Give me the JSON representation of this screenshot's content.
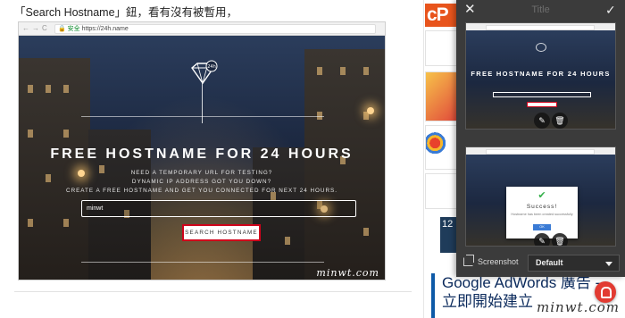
{
  "article": {
    "caption": "「Search Hostname」鈕，看有沒有被暫用，"
  },
  "mini_browser": {
    "nav_glyphs": "←→C",
    "secure_label": "安全",
    "url": "https://24h.name"
  },
  "hero": {
    "logo_text": "24h",
    "title": "FREE HOSTNAME FOR 24 HOURS",
    "sub_lines": [
      "NEED A TEMPORARY URL FOR TESTING?",
      "DYNAMIC IP ADDRESS GOT YOU DOWN?",
      "CREATE A FREE HOSTNAME AND GET YOU CONNECTED FOR NEXT 24 HOURS."
    ],
    "input_value": "minwt",
    "button_label": "SEARCH HOSTNAME",
    "watermark": "minwt.com"
  },
  "sidebar": {
    "cp_logo": "cP",
    "ad_number": "12",
    "ad_title": "Google AdWords 廣告 - 立即開始建立",
    "watermark": "minwt.com"
  },
  "panel": {
    "title": "Title",
    "close_icon": "close-icon",
    "confirm_icon": "checkmark-icon",
    "captures": [
      {
        "title": "FREE HOSTNAME FOR 24 HOURS"
      },
      {
        "modal_head": "Success!",
        "modal_text": "Hostname has been created successfully",
        "modal_button": "OK"
      }
    ],
    "footer": {
      "label": "Screenshot",
      "select_value": "Default"
    }
  },
  "colors": {
    "panel_bg": "#3b3b3b",
    "accent_red": "#d0021b",
    "cp_orange": "#e8541c",
    "ad_blue": "#0e5aa7"
  }
}
